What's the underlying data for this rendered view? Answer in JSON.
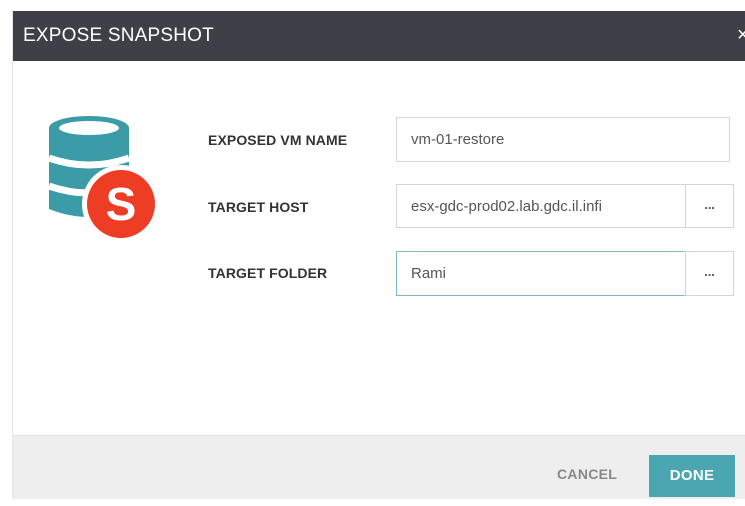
{
  "dialog": {
    "title": "EXPOSE SNAPSHOT",
    "close_glyph": "×"
  },
  "logo": {
    "icon": "database-snapshot-icon",
    "badge_letter": "S",
    "db_color": "#3b9ba6",
    "badge_color": "#ee3d25"
  },
  "form": {
    "exposed_vm_name": {
      "label": "EXPOSED VM NAME",
      "value": "vm-01-restore"
    },
    "target_host": {
      "label": "TARGET HOST",
      "value": "esx-gdc-prod02.lab.gdc.il.infi",
      "browse_label": "..."
    },
    "target_folder": {
      "label": "TARGET FOLDER",
      "value": "Rami",
      "browse_label": "..."
    }
  },
  "footer": {
    "cancel_label": "CANCEL",
    "done_label": "DONE",
    "accent_color": "#4aa6b0"
  }
}
